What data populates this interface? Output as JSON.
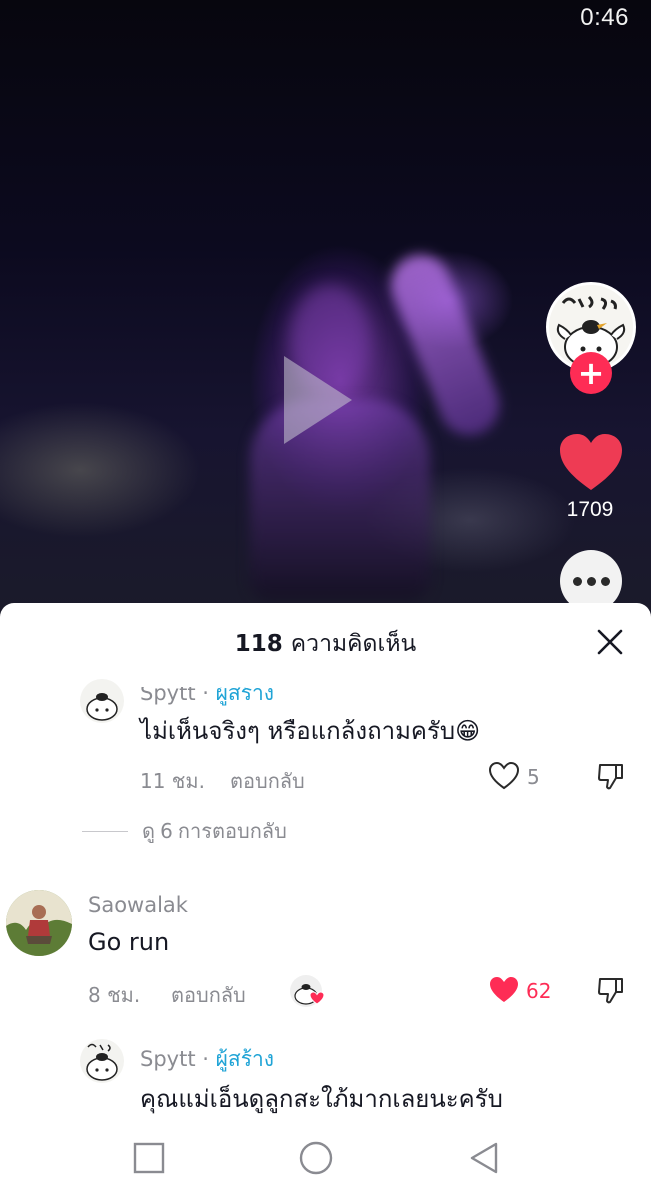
{
  "status": {
    "time": "0:46"
  },
  "video": {
    "like_count": "1709",
    "icons": {
      "play": "play-icon",
      "like": "heart-icon",
      "follow": "plus-icon",
      "more": "more-dots-icon"
    },
    "colors": {
      "accent": "#fe2c55"
    }
  },
  "comments_sheet": {
    "count": "118",
    "title": "ความคิดเห็น",
    "close_icon": "close-icon",
    "comments": [
      {
        "username": "Spytt",
        "creator_label": "ผู้สร้าง",
        "text": "ไม่เห็นจริงๆ หรือแกล้งถามครับ😁",
        "time": "11 ชม.",
        "reply_label": "ตอบกลับ",
        "likes": "5",
        "liked": false
      },
      {
        "username": "Saowalak",
        "text": "Go run",
        "time": "8 ชม.",
        "reply_label": "ตอบกลับ",
        "likes": "62",
        "liked": true
      },
      {
        "username": "Spytt",
        "creator_label": "ผู้สร้าง",
        "text": "คุณแม่เอ็นดูลูกสะใภ้มากเลยนะครับ"
      }
    ],
    "view_replies": {
      "prefix": "ดู",
      "count": "6",
      "suffix": "การตอบกลับ"
    }
  },
  "navbar": {
    "icons": [
      "square-icon",
      "circle-icon",
      "back-triangle-icon"
    ]
  }
}
